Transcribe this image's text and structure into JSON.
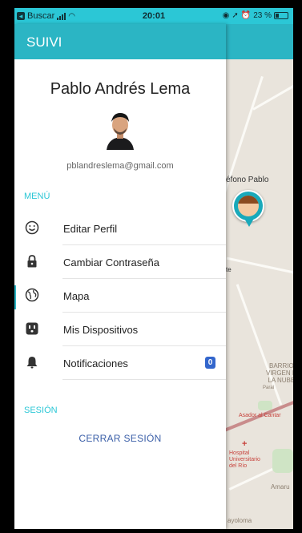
{
  "status_bar": {
    "back_app": "Buscar",
    "time": "20:01",
    "battery": "23 %"
  },
  "app": {
    "title": "SUIVI"
  },
  "profile": {
    "name": "Pablo Andrés Lema",
    "email": "pblandreslema@gmail.com"
  },
  "menu": {
    "section_label": "MENÚ",
    "items": [
      {
        "label": "Editar Perfil",
        "icon": "smiley-icon"
      },
      {
        "label": "Cambiar Contraseña",
        "icon": "lock-icon"
      },
      {
        "label": "Mapa",
        "icon": "globe-icon"
      },
      {
        "label": "Mis Dispositivos",
        "icon": "outlet-icon"
      },
      {
        "label": "Notificaciones",
        "icon": "bell-icon",
        "badge": "0"
      }
    ]
  },
  "session": {
    "section_label": "SESIÓN",
    "logout_label": "CERRAR SESIÓN"
  },
  "map": {
    "device_label": "éfono Pablo",
    "partial_label": "te",
    "neighborhood": "BARRIO\nVIRGEN D\nLA NUBE",
    "poi_asador": "Asador al Cantar",
    "poi_hospital": "Hospital\nUniversitario\ndel Río",
    "road_label": "Paraí",
    "area_amaru": "Amaru",
    "area_bottom": "ayoloma"
  },
  "colors": {
    "accent": "#2bb5c4",
    "status_bar": "#2bc7d6",
    "badge": "#3366cc",
    "logout": "#3b5fa8"
  }
}
